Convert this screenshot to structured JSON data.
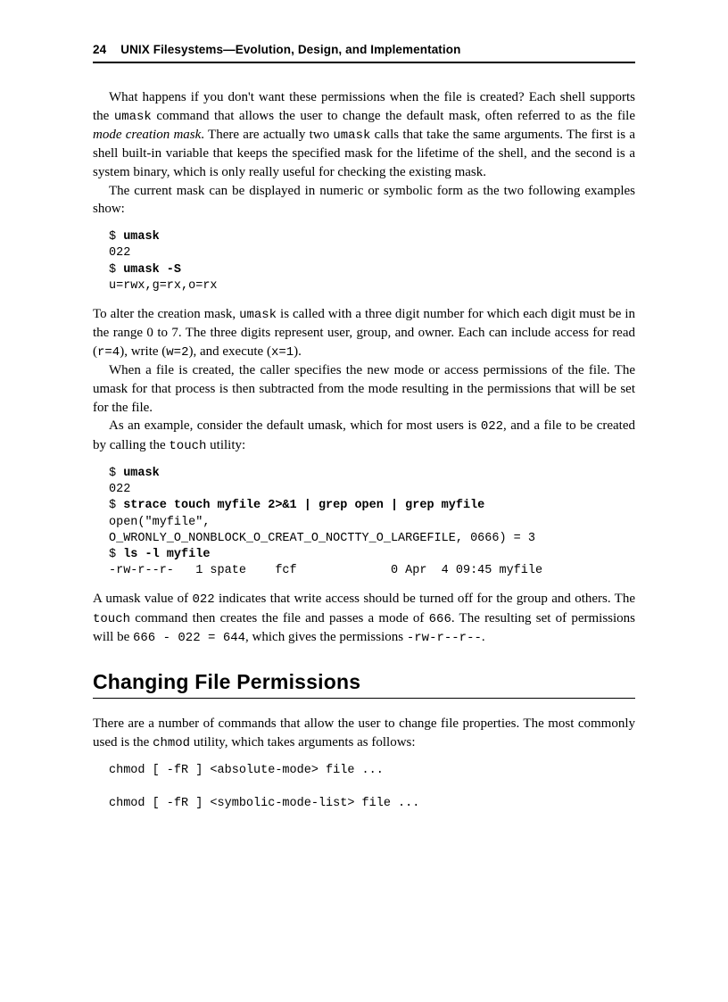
{
  "header": {
    "page_number": "24",
    "title": "UNIX Filesystems—Evolution, Design, and Implementation"
  },
  "p1a": "What happens if you don't want these permissions when the file is created? Each shell supports the ",
  "p1_code1": "umask",
  "p1b": " command that allows the user to change the default mask, often referred to as the file ",
  "p1_em": "mode creation mask",
  "p1c": ". There are actually two ",
  "p1_code2": "umask",
  "p1d": " calls that take the same arguments. The first is a shell built-in variable that keeps the specified mask for the lifetime of the shell, and the second is a system binary, which is only really useful for checking the existing mask.",
  "p2": "The current mask can be displayed in numeric or symbolic form as the two following examples show:",
  "code1": {
    "l1p": "$ ",
    "l1b": "umask",
    "l2": "022",
    "l3p": "$ ",
    "l3b": "umask -S",
    "l4": "u=rwx,g=rx,o=rx"
  },
  "p3a": "To alter the creation mask, ",
  "p3_code1": "umask",
  "p3b": " is called with a three digit number for which each digit must be in the range 0 to 7. The three digits represent user, group, and owner. Each can include access for read (",
  "p3_code2": "r=4",
  "p3c": "), write (",
  "p3_code3": "w=2",
  "p3d": "), and execute (",
  "p3_code4": "x=1",
  "p3e": ").",
  "p4": "When a file is created, the caller specifies the new mode or access permissions of the file. The umask for that process is then subtracted from the mode resulting in the permissions that will be set for the file.",
  "p5a": "As an example, consider the default umask, which for most users is ",
  "p5_code1": "022",
  "p5b": ", and a file to be created by calling the ",
  "p5_code2": "touch",
  "p5c": " utility:",
  "code2": {
    "l1p": "$ ",
    "l1b": "umask",
    "l2": "022",
    "l3p": "$ ",
    "l3b": "strace touch myfile 2>&1 | grep open | grep myfile",
    "l4": "open(\"myfile\",",
    "l5": "O_WRONLY_O_NONBLOCK_O_CREAT_O_NOCTTY_O_LARGEFILE, 0666) = 3",
    "l6p": "$ ",
    "l6b": "ls -l myfile",
    "l7": "-rw-r--r-   1 spate    fcf             0 Apr  4 09:45 myfile"
  },
  "p6a": "A umask value of ",
  "p6_code1": "022",
  "p6b": " indicates that write access should be turned off for the group and others. The ",
  "p6_code2": "touch",
  "p6c": " command then creates the file and passes a mode of ",
  "p6_code3": "666",
  "p6d": ". The resulting set of permissions will be ",
  "p6_code4": "666 - 022 = 644",
  "p6e": ", which gives the permissions ",
  "p6_code5": "-rw-r--r--",
  "p6f": ".",
  "section_title": "Changing File Permissions",
  "p7a": "There are a number of commands that allow the user to change file properties. The most commonly used is the ",
  "p7_code1": "chmod",
  "p7b": " utility, which takes arguments as follows:",
  "code3": {
    "l1": "chmod [ -fR ] <absolute-mode> file ...",
    "blank": "",
    "l2": "chmod [ -fR ] <symbolic-mode-list> file ..."
  }
}
